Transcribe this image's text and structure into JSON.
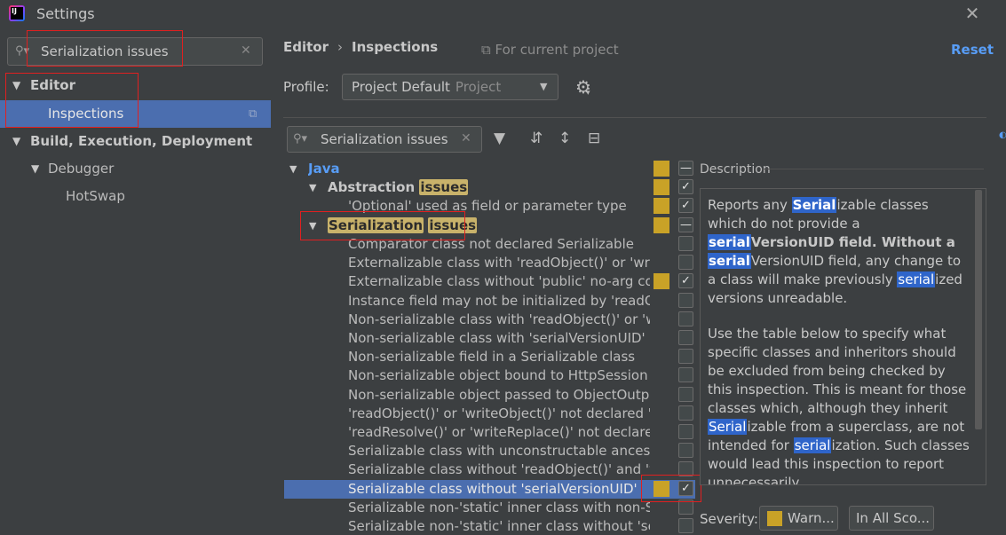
{
  "window": {
    "title": "Settings",
    "close_glyph": "✕"
  },
  "sidebar": {
    "search": {
      "value": "Serialization issues",
      "clear_glyph": "✕"
    },
    "items": [
      {
        "label": "Editor",
        "expanded": true
      },
      {
        "label": "Inspections",
        "selected": true
      },
      {
        "label": "Build, Execution, Deployment",
        "expanded": true
      },
      {
        "label": "Debugger",
        "expanded": true
      },
      {
        "label": "HotSwap"
      }
    ]
  },
  "header": {
    "breadcrumb": [
      "Editor",
      "Inspections"
    ],
    "breadcrumb_sep": "›",
    "scope_note": "For current project",
    "reset": "Reset"
  },
  "profile": {
    "label": "Profile:",
    "value": "Project Default",
    "type": "Project"
  },
  "inspection_search": {
    "value": "Serialization issues",
    "clear_glyph": "✕"
  },
  "tree": {
    "java": "Java",
    "abstraction_prefix": "Abstraction",
    "abstraction_hl": "issues",
    "optional_item": "'Optional' used as field or parameter type",
    "serialization_hl1": "Serialization",
    "serialization_hl2": "issues",
    "items": [
      {
        "label": "Comparator class not declared Serializable",
        "severity": false,
        "checked": false
      },
      {
        "label": "Externalizable class with 'readObject()' or 'writeObject()'",
        "severity": false,
        "checked": false
      },
      {
        "label": "Externalizable class without 'public' no-arg constructor",
        "severity": true,
        "checked": true
      },
      {
        "label": "Instance field may not be initialized by 'readObject()'",
        "severity": false,
        "checked": false
      },
      {
        "label": "Non-serializable class with 'readObject()' or 'writeObject()'",
        "severity": false,
        "checked": false
      },
      {
        "label": "Non-serializable class with 'serialVersionUID'",
        "severity": false,
        "checked": false
      },
      {
        "label": "Non-serializable field in a Serializable class",
        "severity": false,
        "checked": false
      },
      {
        "label": "Non-serializable object bound to HttpSession",
        "severity": false,
        "checked": false
      },
      {
        "label": "Non-serializable object passed to ObjectOutputStream",
        "severity": false,
        "checked": false
      },
      {
        "label": "'readObject()' or 'writeObject()' not declared 'private'",
        "severity": false,
        "checked": false
      },
      {
        "label": "'readResolve()' or 'writeReplace()' not declared 'protected'",
        "severity": false,
        "checked": false
      },
      {
        "label": "Serializable class with unconstructable ancestor",
        "severity": false,
        "checked": false
      },
      {
        "label": "Serializable class without 'readObject()' and 'writeObject()'",
        "severity": false,
        "checked": false
      },
      {
        "label": "Serializable class without 'serialVersionUID'",
        "severity": true,
        "checked": true,
        "selected": true
      },
      {
        "label": "Serializable non-'static' inner class with non-Serializable outer class",
        "severity": false,
        "checked": false
      },
      {
        "label": "Serializable non-'static' inner class without 'serialVersionUID'",
        "severity": false,
        "checked": false
      }
    ]
  },
  "description": {
    "label": "Description",
    "p1": {
      "a": "Reports any ",
      "k1": "Serial",
      "b": "izable classes which do not provide a ",
      "k2": "serial",
      "c": "VersionUID field. Without a ",
      "k3": "serial",
      "d": "VersionUID field, any change to a class will make previously ",
      "k4": "serial",
      "e": "ized versions unreadable."
    },
    "p2": {
      "a": "Use the table below to specify what specific classes and inheritors should be excluded from being checked by this inspection. This is meant for those classes which, although they inherit ",
      "k1": "Serial",
      "b": "izable from a superclass, are not intended for ",
      "k2": "serial",
      "c": "ization. Such classes would lead this inspection to report unnecessarily."
    }
  },
  "severity": {
    "label": "Severity:",
    "value": "Warn...",
    "color": "#c9a227"
  },
  "scope": {
    "value": "In All Sco..."
  },
  "colors": {
    "accent": "#589df6",
    "selection": "#4b6eaf",
    "warning": "#c9a227",
    "highlight_red": "#e02020"
  }
}
